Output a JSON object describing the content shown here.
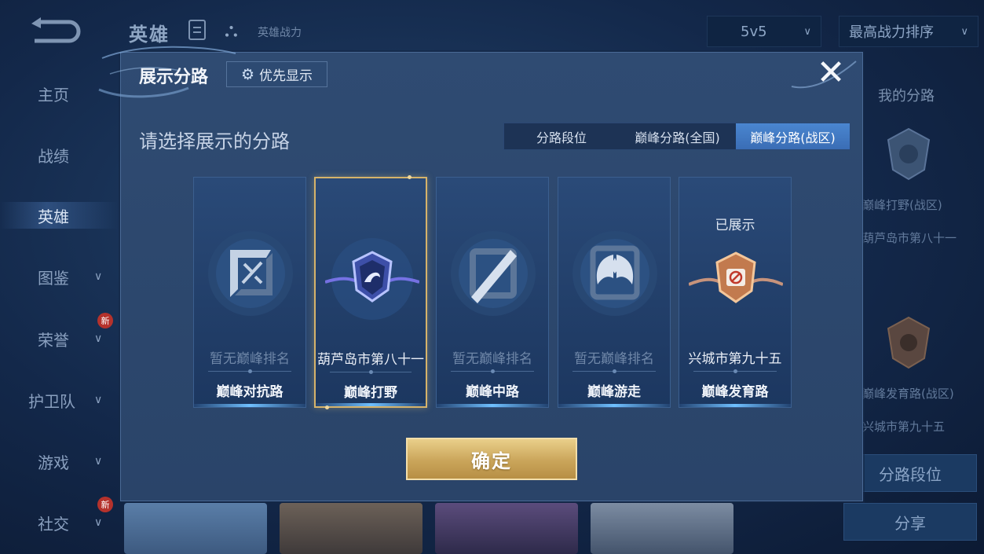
{
  "header": {
    "title": "英雄",
    "power_label": "英雄战力",
    "mode_select": "5v5",
    "sort_select": "最高战力排序"
  },
  "sidebar": {
    "items": [
      {
        "label": "主页"
      },
      {
        "label": "战绩"
      },
      {
        "label": "英雄",
        "active": true
      },
      {
        "label": "图鉴"
      },
      {
        "label": "荣誉",
        "badge": "新"
      },
      {
        "label": "护卫队"
      },
      {
        "label": "游戏"
      },
      {
        "label": "社交",
        "badge": "新"
      }
    ]
  },
  "right_panel": {
    "heading": "我的分路",
    "items": [
      {
        "lane": "巅峰打野(战区)",
        "rank": "葫芦岛市第八十一"
      },
      {
        "lane": "巅峰发育路(战区)",
        "rank": "兴城市第九十五"
      }
    ],
    "lane_rank_button": "分路段位",
    "share_button": "分享"
  },
  "modal": {
    "title": "展示分路",
    "priority_button": "优先显示",
    "section_title": "请选择展示的分路",
    "tabs": [
      {
        "label": "分路段位",
        "active": false
      },
      {
        "label": "巅峰分路(全国)",
        "active": false
      },
      {
        "label": "巅峰分路(战区)",
        "active": true
      }
    ],
    "cards": [
      {
        "lane": "巅峰对抗路",
        "rank": "暂无巅峰排名",
        "icon": "clash-lane-icon",
        "selected": false,
        "shown": ""
      },
      {
        "lane": "巅峰打野",
        "rank": "葫芦岛市第八十一",
        "icon": "jungle-emblem-icon",
        "selected": true,
        "shown": ""
      },
      {
        "lane": "巅峰中路",
        "rank": "暂无巅峰排名",
        "icon": "mid-lane-icon",
        "selected": false,
        "shown": ""
      },
      {
        "lane": "巅峰游走",
        "rank": "暂无巅峰排名",
        "icon": "roam-wings-icon",
        "selected": false,
        "shown": ""
      },
      {
        "lane": "巅峰发育路",
        "rank": "兴城市第九十五",
        "icon": "farm-lane-emblem-icon",
        "selected": false,
        "shown": "已展示"
      }
    ],
    "confirm_button": "确定"
  },
  "colors": {
    "accent_blue": "#3a6db5",
    "gold": "#caa55a",
    "panel": "#2f4b72",
    "badge_red": "#b5322c"
  }
}
